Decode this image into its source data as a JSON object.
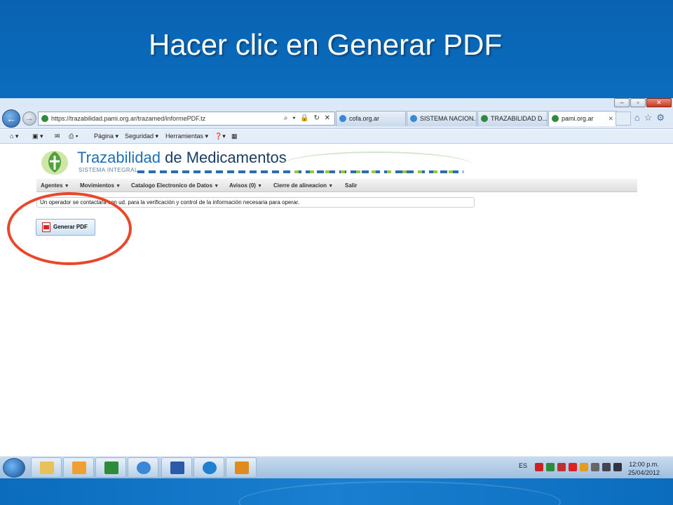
{
  "slide": {
    "title": "Hacer clic en Generar PDF"
  },
  "browser": {
    "url": "https://trazabilidad.pami.org.ar/trazamed/informePDF.tz",
    "tabs": [
      {
        "label": "cofa.org.ar",
        "icon": "ie-icon"
      },
      {
        "label": "SISTEMA NACION...",
        "icon": "ie-icon"
      },
      {
        "label": "TRAZABILIDAD D...",
        "icon": "shield-icon"
      },
      {
        "label": "pami.org.ar",
        "icon": "shield-icon",
        "active": true
      }
    ],
    "window_controls": [
      "–",
      "▫",
      "✕"
    ],
    "command_bar": {
      "pagina": "Página ▾",
      "seguridad": "Seguridad ▾",
      "herramientas": "Herramientas ▾"
    }
  },
  "app": {
    "brand_prefix": "Trazabilidad",
    "brand_suffix": " de Medicamentos",
    "brand_sub": "SISTEMA INTEGRAL",
    "menu": [
      {
        "label": "Agentes"
      },
      {
        "label": "Movimientos"
      },
      {
        "label": "Catalogo Electronico de Datos"
      },
      {
        "label": "Avisos (0)"
      },
      {
        "label": "Cierre de alineacion"
      },
      {
        "label": "Salir"
      }
    ],
    "info_message": "Un operador se contactará con ud. para la verificación y control de la información necesaria para operar.",
    "pdf_button": "Generar PDF"
  },
  "taskbar": {
    "language": "ES",
    "time": "12:00 p.m.",
    "date": "25/04/2012",
    "apps": [
      "explorer-icon",
      "outlook-icon",
      "excel-icon",
      "ie-icon",
      "word-icon",
      "skype-icon",
      "media-icon"
    ]
  },
  "colors": {
    "slide_bg": "#0a62b0",
    "highlight": "#e8472a",
    "brand": "#1a3d64"
  }
}
